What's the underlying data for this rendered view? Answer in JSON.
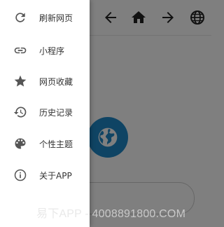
{
  "toolbar": {
    "buttons": [
      {
        "icon": "arrow-left-icon"
      },
      {
        "icon": "home-icon"
      },
      {
        "icon": "arrow-right-icon"
      },
      {
        "icon": "globe-icon"
      }
    ]
  },
  "content": {
    "logo_icon": "globe-icon",
    "logo_color": "#1e88c8"
  },
  "drawer": {
    "items": [
      {
        "label": "刷新网页",
        "icon": "refresh-icon"
      },
      {
        "label": "小程序",
        "icon": "link-icon"
      },
      {
        "label": "网页收藏",
        "icon": "star-icon"
      },
      {
        "label": "历史记录",
        "icon": "history-icon"
      },
      {
        "label": "个性主题",
        "icon": "palette-icon"
      },
      {
        "label": "关于APP",
        "icon": "info-icon"
      }
    ]
  },
  "watermark": "易下APP - 4008891800.COM"
}
